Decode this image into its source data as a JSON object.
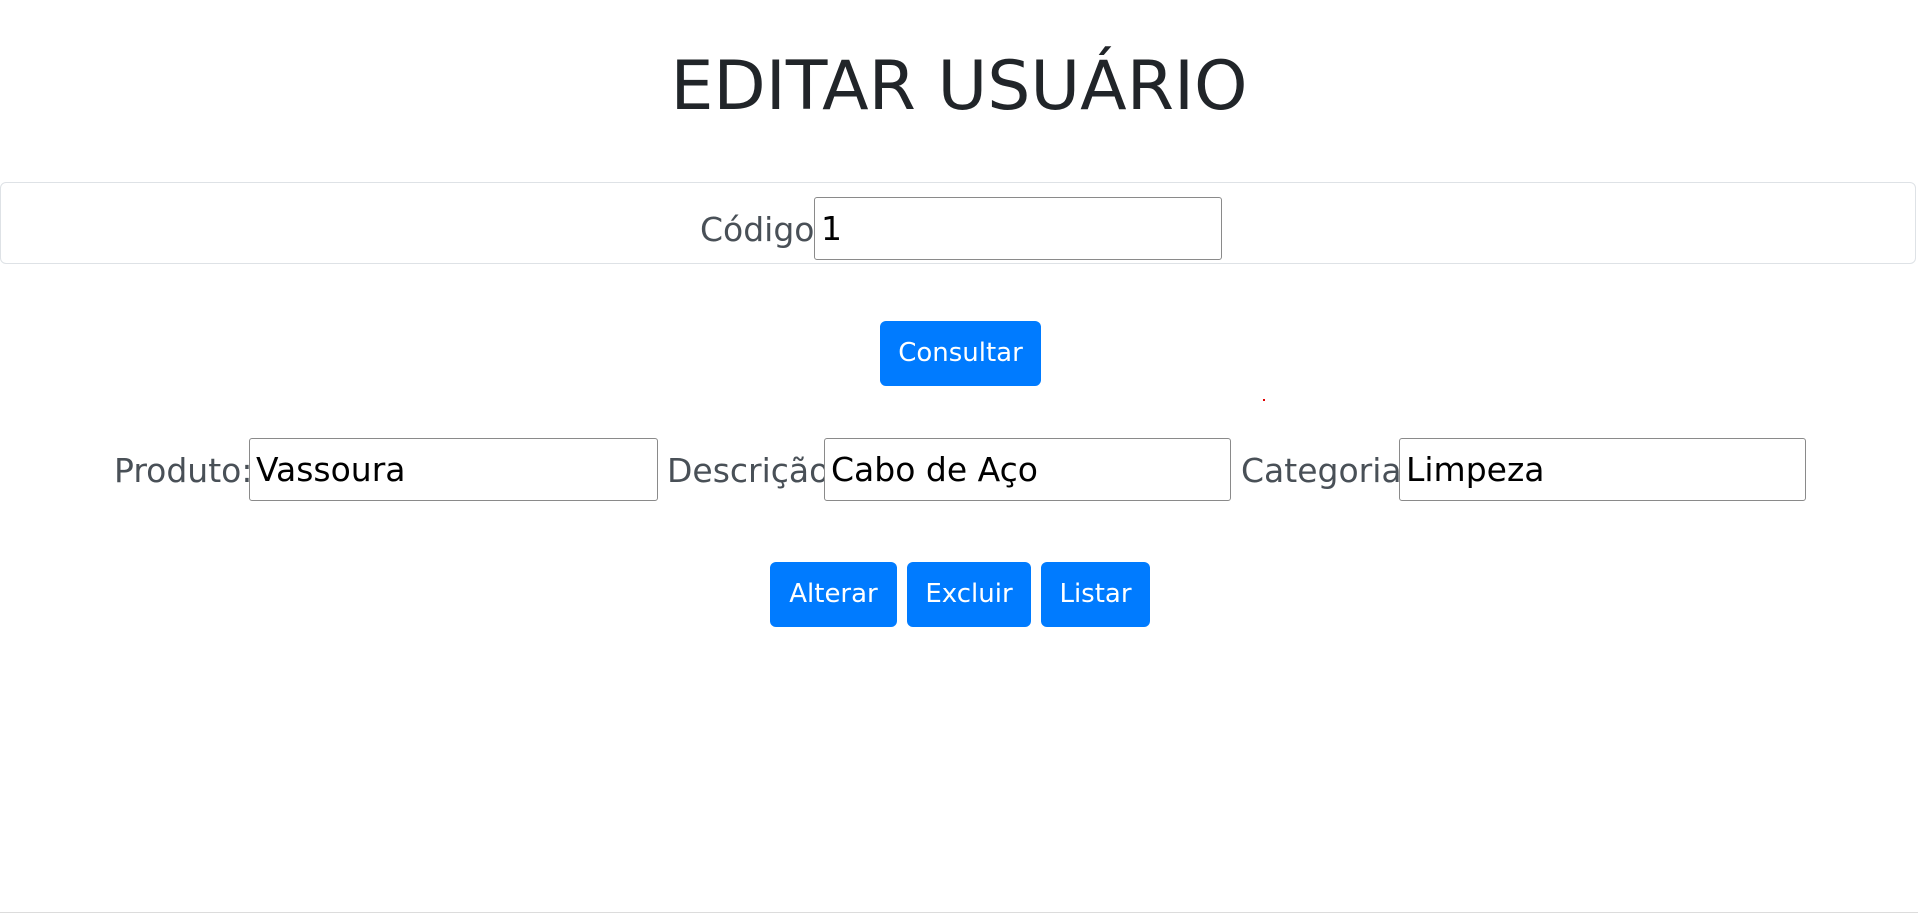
{
  "title": "EDITAR USUÁRIO",
  "lookup": {
    "code_label": "Código",
    "code_value": "1",
    "consult_button": "Consultar"
  },
  "form": {
    "product_label": "Produto:",
    "product_value": "Vassoura",
    "description_label": "Descrição:",
    "description_value": "Cabo de Aço",
    "category_label": "Categoria:",
    "category_value": "Limpeza"
  },
  "actions": {
    "update_button": "Alterar",
    "delete_button": "Excluir",
    "list_button": "Listar"
  },
  "colors": {
    "primary": "#007bff",
    "text_dark": "#212529",
    "label_gray": "#495057",
    "panel_border": "#dee2e6"
  }
}
